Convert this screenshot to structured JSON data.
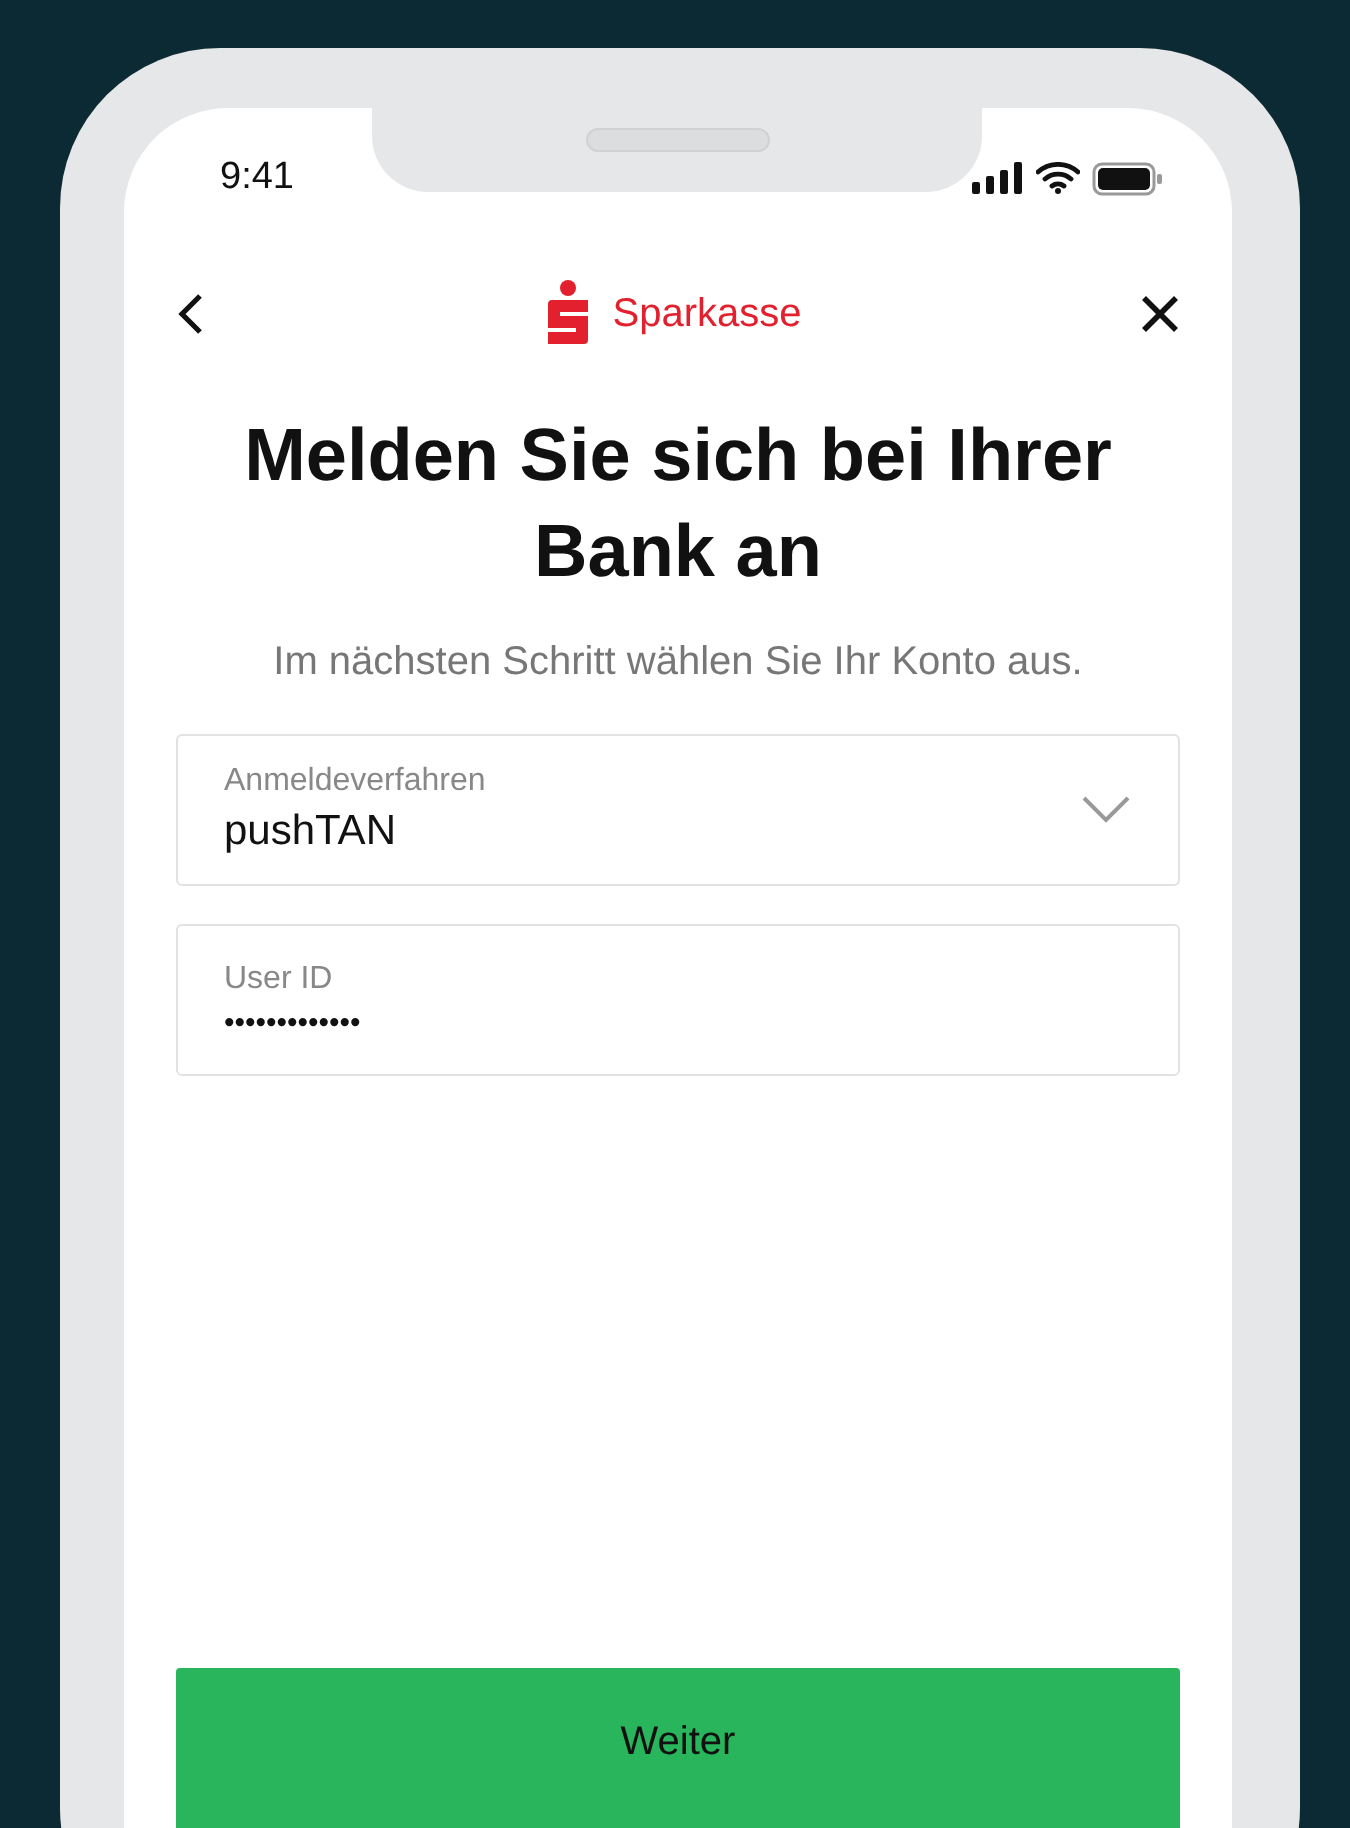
{
  "status_bar": {
    "time": "9:41"
  },
  "header": {
    "brand": "Sparkasse"
  },
  "title": "Melden Sie sich bei Ihrer Bank an",
  "subtitle": "Im nächsten Schritt wählen Sie Ihr Konto aus.",
  "fields": [
    {
      "kind": "select",
      "label": "Anmeldeverfahren",
      "value": "pushTAN"
    },
    {
      "kind": "password",
      "label": "User ID",
      "value": "•••••••••••••"
    }
  ],
  "button": "Weiter"
}
